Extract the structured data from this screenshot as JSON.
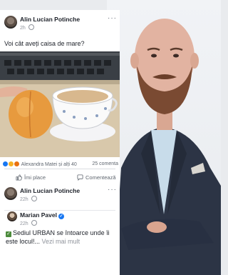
{
  "post1": {
    "author": "Alin Lucian Potinche",
    "time": "2h",
    "text": "Voi cât aveți caisa de mare?",
    "reactions_text": "Alexandra Matei și alți 40",
    "comments_text": "25 comenta",
    "like_label": "Îmi place",
    "comment_label": "Comentează",
    "more_label": "···"
  },
  "post2": {
    "author": "Alin Lucian Potinche",
    "time": "22h",
    "more_label": "···",
    "shared": {
      "author": "Marian Pavel",
      "time": "22h",
      "text": "Sediul URBAN se întoarce unde îi este locul!...",
      "more_link": "Vezi mai mult"
    }
  },
  "colors": {
    "like_blue": "#1877f2",
    "text": "#1d2129",
    "muted": "#90949c"
  },
  "icons": [
    "globe-icon",
    "like-icon",
    "comment-icon",
    "verified-icon",
    "check-icon"
  ]
}
